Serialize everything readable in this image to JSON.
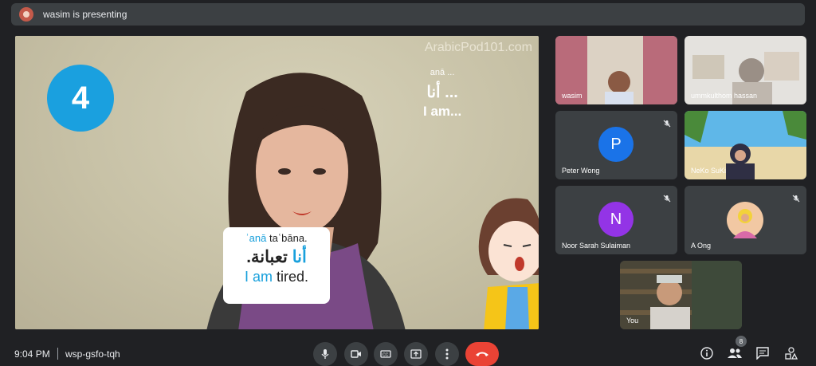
{
  "topbar": {
    "presenting_text": "wasim is presenting"
  },
  "presentation": {
    "watermark": "ArabicPod101.com",
    "lesson_number": "4",
    "phrase": {
      "transliteration": "anā ...",
      "arabic": "أنا ...",
      "english": "I am..."
    },
    "subtitle": {
      "translit_hl": "ʾanā",
      "translit_rest": " taʿbāna.",
      "arabic_hl": "أنا",
      "arabic_rest": " تعبانة.",
      "english_hl": "I am",
      "english_rest": " tired."
    }
  },
  "participants": [
    {
      "name": "wasim"
    },
    {
      "name": "ummkulthom hassan"
    },
    {
      "name": "Peter Wong",
      "initial": "P",
      "avatar_color": "#1a73e8"
    },
    {
      "name": "NeKo SuKi"
    },
    {
      "name": "Noor Sarah Sulaiman",
      "initial": "N",
      "avatar_color": "#9334e6"
    },
    {
      "name": "A Ong"
    },
    {
      "name": "You"
    }
  ],
  "bottombar": {
    "time": "9:04 PM",
    "meeting_code": "wsp-gsfo-tqh",
    "participant_count": "8"
  },
  "colors": {
    "accent_blue": "#18a0dc",
    "end_call": "#ea4335"
  }
}
